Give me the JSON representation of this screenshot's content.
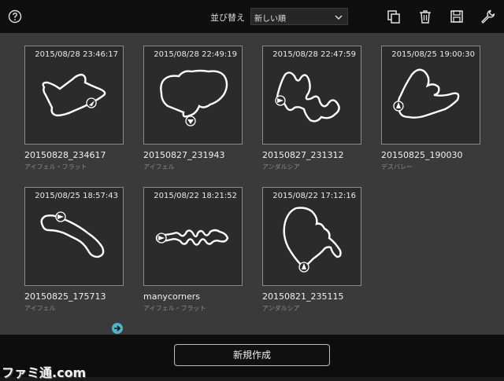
{
  "toolbar": {
    "sort_label": "並び替え",
    "sort_value": "新しい順",
    "icons": [
      "help-icon",
      "copy-icon",
      "trash-icon",
      "save-icon",
      "wrench-icon"
    ]
  },
  "cards": [
    {
      "timestamp": "2015/08/28 23:46:17",
      "name": "20150828_234617",
      "location": "アイフェル・フラット"
    },
    {
      "timestamp": "2015/08/28 22:49:19",
      "name": "20150827_231943",
      "location": "アイフェル"
    },
    {
      "timestamp": "2015/08/28 22:47:59",
      "name": "20150827_231312",
      "location": "アンダルシア"
    },
    {
      "timestamp": "2015/08/25 19:00:30",
      "name": "20150825_190030",
      "location": "デスバレー"
    },
    {
      "timestamp": "2015/08/25 18:57:43",
      "name": "20150825_175713",
      "location": "アイフェル"
    },
    {
      "timestamp": "2015/08/22 18:21:52",
      "name": "manycorners",
      "location": "アイフェル・フラット"
    },
    {
      "timestamp": "2015/08/22 17:12:16",
      "name": "20150821_235115",
      "location": "アンダルシア"
    }
  ],
  "bottom": {
    "new_button": "新規作成"
  },
  "watermark": "ファミ通.com",
  "colors": {
    "share_badge": "#4fb3c8",
    "background": "#3a3a3a"
  }
}
